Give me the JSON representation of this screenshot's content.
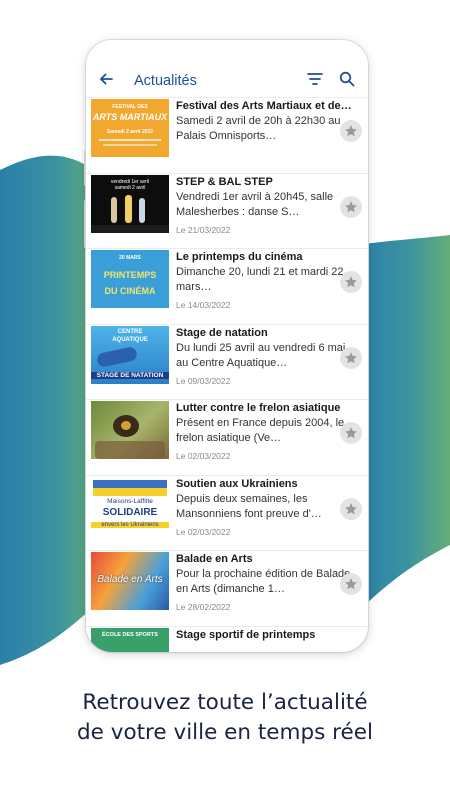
{
  "appbar": {
    "title": "Actualités",
    "icons": [
      "back-arrow-icon",
      "sort-icon",
      "search-icon"
    ]
  },
  "items": [
    {
      "title": "Festival des Arts Martiaux et de l'inclusion",
      "desc": "Samedi 2 avril de 20h à 22h30 au Palais Omnisports…",
      "date": "",
      "thumb": {
        "text1": "FESTIVAL DES",
        "text2": "ARTS MARTIAUX",
        "text3": "Samedi 2 avril 2022"
      }
    },
    {
      "title": "STEP & BAL STEP",
      "desc": "Vendredi 1er avril à 20h45, salle Malesherbes : danse S…",
      "date": "Le 21/03/2022",
      "thumb": {
        "text1": "vendredi 1er avril",
        "text2": "samedi 2 avril",
        "text3": ""
      }
    },
    {
      "title": "Le printemps du cinéma",
      "desc": "Dimanche 20, lundi 21 et mardi 22 mars…",
      "date": "Le 14/03/2022",
      "thumb": {
        "text1": "20 MARS",
        "text2": "PRINTEMPS",
        "text3": "DU CINÉMA"
      }
    },
    {
      "title": "Stage de natation",
      "desc": "Du lundi 25 avril au vendredi 6 mai au Centre Aquatique…",
      "date": "Le 09/03/2022",
      "thumb": {
        "text1": "CENTRE",
        "text2": "AQUATIQUE",
        "text3": "STAGE DE NATATION"
      }
    },
    {
      "title": "Lutter contre le frelon asiatique",
      "desc": "Présent en France depuis 2004, le frelon asiatique (Ve…",
      "date": "Le 02/03/2022",
      "thumb": {
        "text1": "",
        "text2": "",
        "text3": ""
      }
    },
    {
      "title": "Soutien aux Ukrainiens",
      "desc": "Depuis deux semaines, les Mansonniens font preuve d'…",
      "date": "Le 02/03/2022",
      "thumb": {
        "text1": "Maisons-Laffitte",
        "text2": "SOLIDAIRE",
        "text3": "envers les Ukrainiens"
      }
    },
    {
      "title": "Balade en Arts",
      "desc": "Pour la prochaine édition de Balade en Arts (dimanche 1…",
      "date": "Le 28/02/2022",
      "thumb": {
        "text1": "",
        "text2": "Balade en Arts",
        "text3": ""
      }
    },
    {
      "title": "Stage sportif de printemps",
      "desc": "",
      "date": "",
      "thumb": {
        "text1": "ÉCOLE DES SPORTS",
        "text2": "",
        "text3": ""
      }
    }
  ],
  "caption": {
    "line1": "Retrouvez toute l’actualité",
    "line2": "de votre ville en temps réel"
  },
  "colors": {
    "accent": "#1f4f9c",
    "blob_left": "#2b82a8",
    "blob_right": "#5aa77d"
  }
}
